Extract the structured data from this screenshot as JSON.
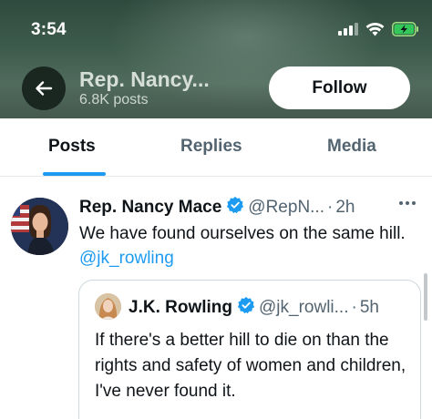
{
  "status_bar": {
    "time": "3:54"
  },
  "header": {
    "profile_name": "Rep. Nancy...",
    "post_count": "6.8K posts",
    "follow_label": "Follow"
  },
  "tabs": [
    {
      "label": "Posts",
      "active": true
    },
    {
      "label": "Replies",
      "active": false
    },
    {
      "label": "Media",
      "active": false
    }
  ],
  "post": {
    "author": "Rep. Nancy Mace",
    "handle": "@RepN...",
    "separator": "·",
    "time": "2h",
    "text": "We have found ourselves on the same hill.",
    "mention": "@jk_rowling",
    "quote": {
      "author": "J.K. Rowling",
      "handle": "@jk_rowli...",
      "separator": "·",
      "time": "5h",
      "text": "If there's a better hill to die on than the rights and safety of women and children, I've never found it."
    }
  },
  "colors": {
    "accent": "#1d9bf0",
    "text_primary": "#0f1419",
    "text_secondary": "#536471",
    "header_bg": "#3d5b4c"
  },
  "icons": {
    "back": "arrow-left-icon",
    "verified": "verified-badge-icon",
    "more": "more-horizontal-icon",
    "signal": "cellular-signal-icon",
    "wifi": "wifi-icon",
    "battery": "battery-charging-icon"
  }
}
